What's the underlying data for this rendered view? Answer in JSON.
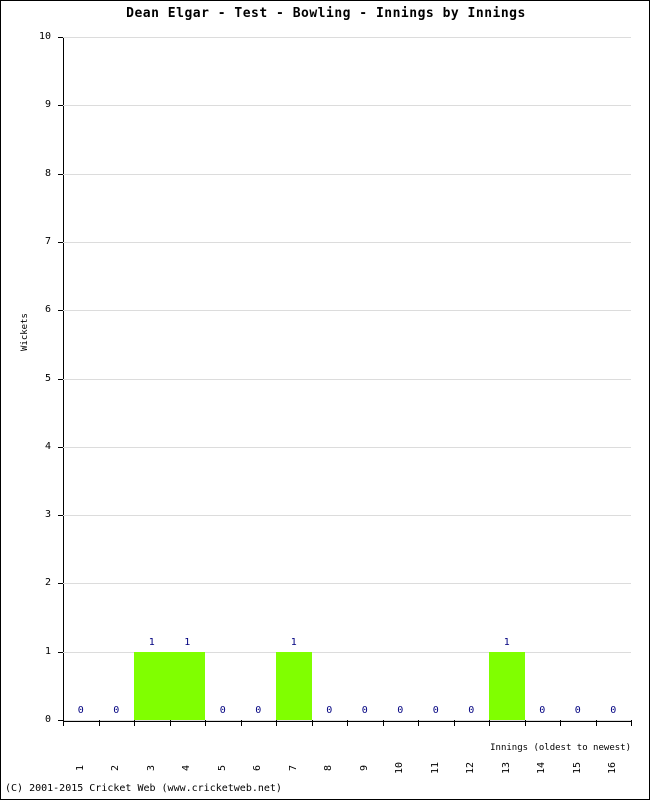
{
  "chart_data": {
    "type": "bar",
    "title": "Dean Elgar - Test - Bowling - Innings by Innings",
    "xlabel": "Innings (oldest to newest)",
    "ylabel": "Wickets",
    "categories": [
      "1",
      "2",
      "3",
      "4",
      "5",
      "6",
      "7",
      "8",
      "9",
      "10",
      "11",
      "12",
      "13",
      "14",
      "15",
      "16"
    ],
    "values": [
      0,
      0,
      1,
      1,
      0,
      0,
      1,
      0,
      0,
      0,
      0,
      0,
      1,
      0,
      0,
      0
    ],
    "ylim": [
      0,
      10
    ],
    "yticks": [
      "0",
      "1",
      "2",
      "3",
      "4",
      "5",
      "6",
      "7",
      "8",
      "9",
      "10"
    ],
    "grid": true,
    "legend": "none",
    "bar_color": "#80FF00",
    "value_label_color": "#000080"
  },
  "footer": {
    "copyright": "(C) 2001-2015 Cricket Web (www.cricketweb.net)"
  }
}
